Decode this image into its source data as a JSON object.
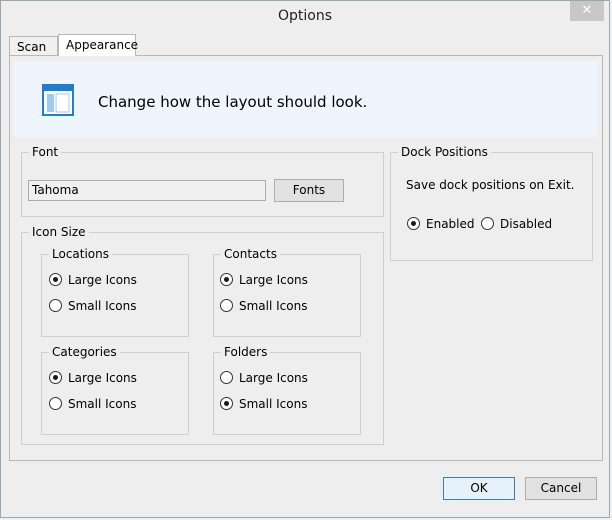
{
  "window": {
    "title": "Options",
    "close_glyph": "✕"
  },
  "tabs": [
    {
      "label": "Scan"
    },
    {
      "label": "Appearance",
      "selected": true
    }
  ],
  "banner": {
    "icon": "layout-window-icon",
    "text": "Change how the layout should look."
  },
  "font": {
    "label": "Font",
    "value": "Tahoma",
    "button_label": "Fonts"
  },
  "dock": {
    "label": "Dock Positions",
    "description": "Save dock positions on Exit.",
    "options": [
      {
        "label": "Enabled",
        "checked": true
      },
      {
        "label": "Disabled",
        "checked": false
      }
    ]
  },
  "icon_size": {
    "label": "Icon Size",
    "groups": [
      {
        "label": "Locations",
        "options": [
          {
            "label": "Large Icons",
            "checked": true
          },
          {
            "label": "Small Icons",
            "checked": false
          }
        ]
      },
      {
        "label": "Contacts",
        "options": [
          {
            "label": "Large Icons",
            "checked": true
          },
          {
            "label": "Small Icons",
            "checked": false
          }
        ]
      },
      {
        "label": "Categories",
        "options": [
          {
            "label": "Large Icons",
            "checked": true
          },
          {
            "label": "Small Icons",
            "checked": false
          }
        ]
      },
      {
        "label": "Folders",
        "options": [
          {
            "label": "Large Icons",
            "checked": false
          },
          {
            "label": "Small Icons",
            "checked": true
          }
        ]
      }
    ]
  },
  "footer": {
    "ok_label": "OK",
    "cancel_label": "Cancel"
  }
}
